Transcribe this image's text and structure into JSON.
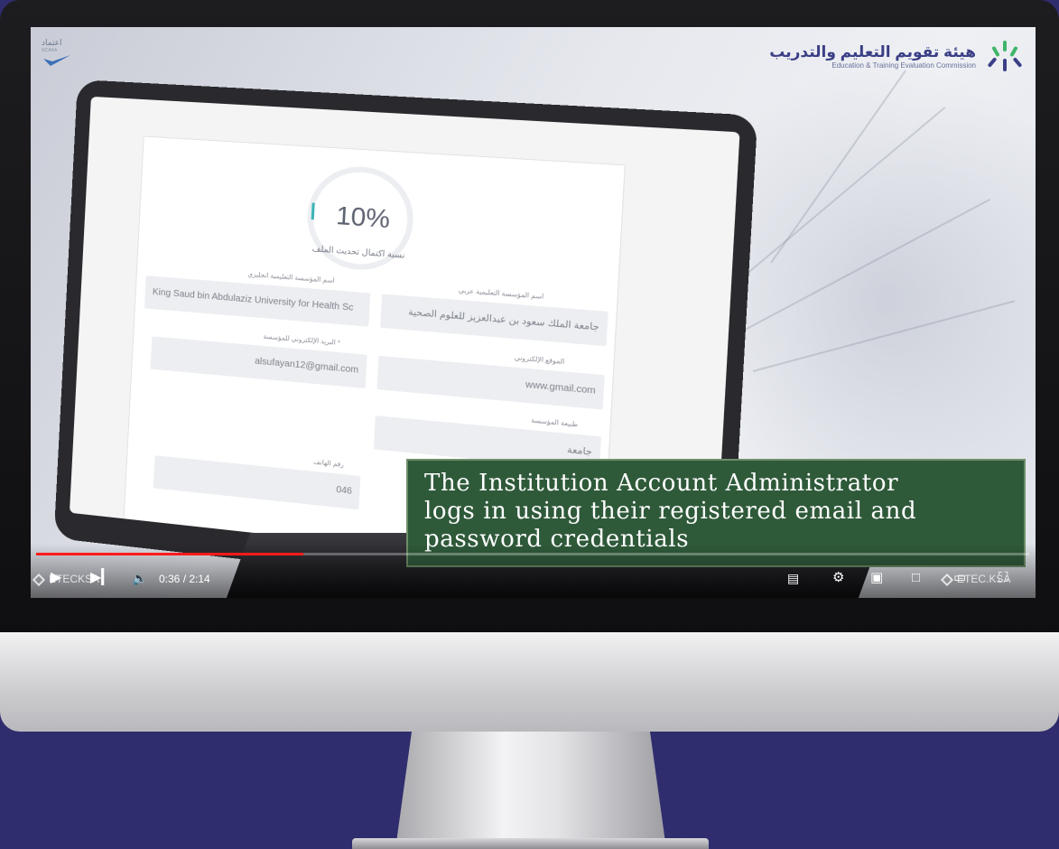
{
  "logos": {
    "left_arabic": "اعتماد",
    "left_small": "NCAAA",
    "right_arabic": "هيئة تقويم التعليم والتدريب",
    "right_english": "Education & Training Evaluation Commission"
  },
  "form": {
    "progress_percent": "10%",
    "progress_fraction": 0.1,
    "progress_label": "نسبة اكتمال تحديث الملف",
    "fields": [
      {
        "label": "اسم المؤسسة التعليمية عربي",
        "value": "جامعة الملك سعود بن عبدالعزيز للعلوم الصحية"
      },
      {
        "label": "اسم المؤسسة التعليمية انجليزي",
        "value": "King Saud bin Abdulaziz University for Health Sc"
      },
      {
        "label": "الموقع الإلكتروني",
        "value": "www.gmail.com"
      },
      {
        "label": "البريد الإلكتروني للمؤسسة *",
        "value": "alsufayan12@gmail.com"
      },
      {
        "label": "طبيعة المؤسسة",
        "value": "جامعة"
      },
      {
        "label": "رقم الهاتف",
        "value": "046"
      }
    ]
  },
  "caption": {
    "line1": "The Institution Account Administrator",
    "line2": "logs in using their registered email and",
    "line3": "password credentials"
  },
  "player": {
    "time": "0:36 / 2:14",
    "progress_fraction": 0.269,
    "watermark_left": "ETECKSA",
    "watermark_right": "ETEC.KSA",
    "accent": "#ff1b1b"
  },
  "colors": {
    "background": "#2f2d6e",
    "caption_bg": "#2f5a3a"
  }
}
